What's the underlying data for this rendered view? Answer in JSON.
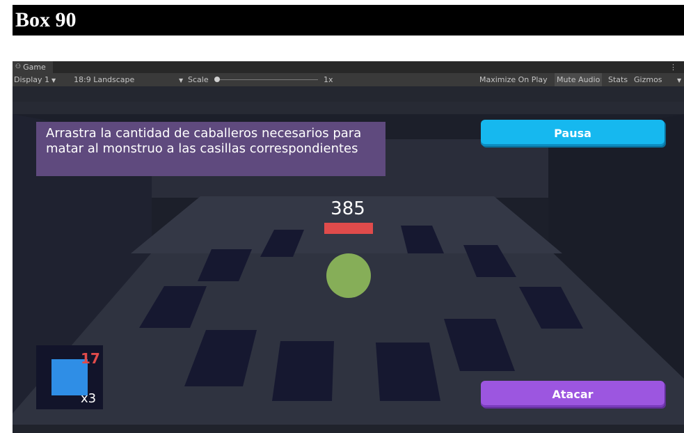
{
  "header": {
    "title": "Box 90"
  },
  "editor": {
    "tab": {
      "label": "Game",
      "icon": "gamepad-icon"
    },
    "toolbar": {
      "display": "Display 1",
      "aspect": "18:9 Landscape",
      "scale_label": "Scale",
      "scale_value": "1x",
      "maximize": "Maximize On Play",
      "mute": "Mute Audio",
      "stats": "Stats",
      "gizmos": "Gizmos"
    }
  },
  "game": {
    "instructions": "Arrastra la cantidad de caballeros necesarios para matar al monstruo a las casillas correspondientes",
    "pause_label": "Pausa",
    "attack_label": "Atacar",
    "monster": {
      "hp": "385",
      "color": "#86ae58"
    },
    "knight": {
      "power": "17",
      "count": "x3",
      "color": "#2f8ee6"
    },
    "colors": {
      "hp_bar": "#e04b4b",
      "pause": "#16b8ef",
      "attack": "#9c56e0",
      "panel": "#5f4a7e"
    }
  }
}
